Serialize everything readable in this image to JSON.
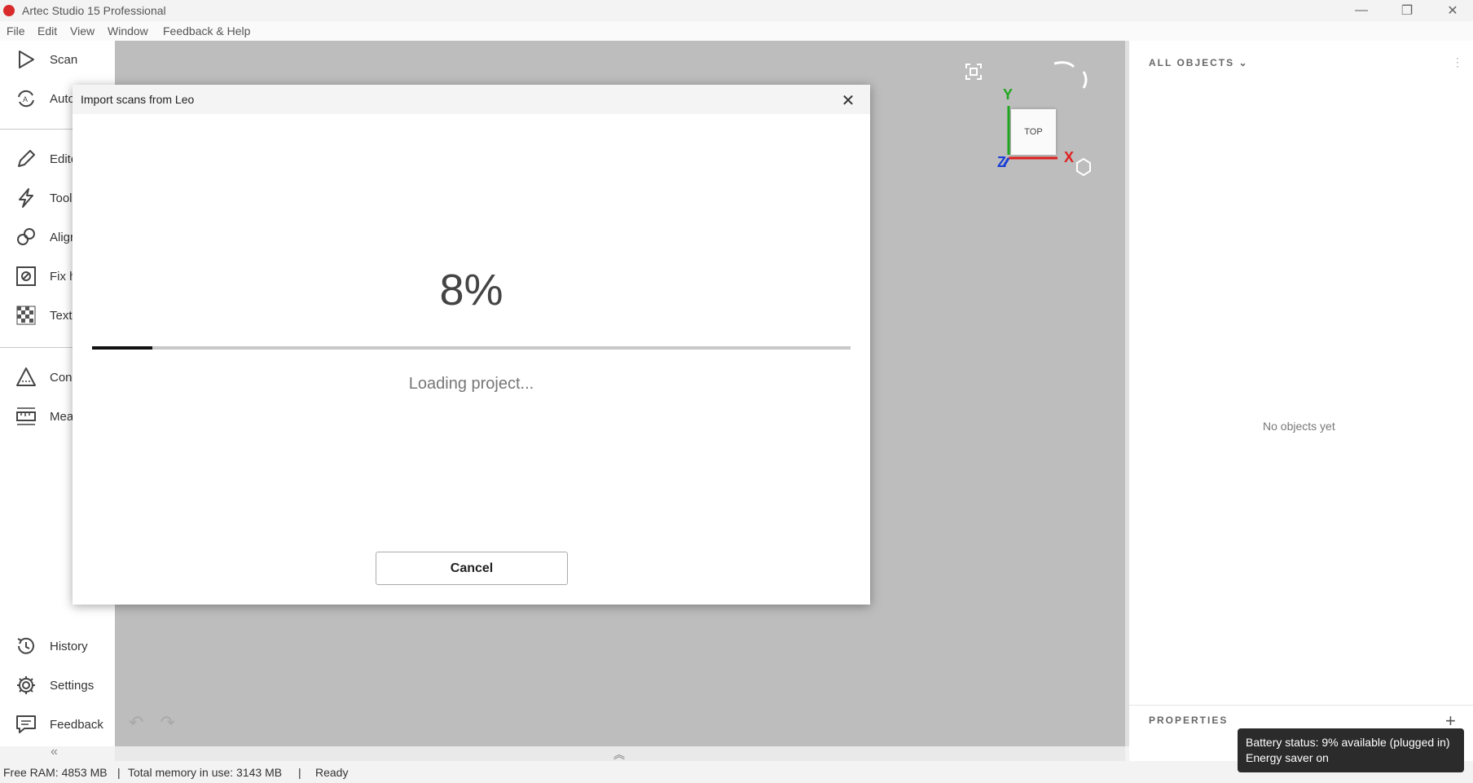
{
  "window": {
    "title": "Artec Studio 15 Professional",
    "minimize_glyph": "—",
    "restore_glyph": "❐",
    "close_glyph": "✕"
  },
  "menu": {
    "items": [
      "File",
      "Edit",
      "View",
      "Window",
      "Feedback & Help"
    ]
  },
  "sidebar": {
    "items": [
      {
        "label": "Scan",
        "icon": "scan-icon"
      },
      {
        "label": "Auto",
        "icon": "autopilot-icon"
      },
      {
        "label": "Edito",
        "icon": "pencil-icon"
      },
      {
        "label": "Tool",
        "icon": "lightning-icon"
      },
      {
        "label": "Aligr",
        "icon": "align-icon"
      },
      {
        "label": "Fix h",
        "icon": "fix-holes-icon"
      },
      {
        "label": "Text",
        "icon": "texture-icon"
      },
      {
        "label": "Cons",
        "icon": "construct-icon"
      },
      {
        "label": "Mea",
        "icon": "ruler-icon"
      }
    ],
    "bottom_items": [
      {
        "label": "History",
        "icon": "history-icon"
      },
      {
        "label": "Settings",
        "icon": "gear-icon"
      },
      {
        "label": "Feedback",
        "icon": "chat-icon"
      }
    ],
    "collapse_glyph": "«"
  },
  "viewport": {
    "view_cube_label": "TOP",
    "axis_x": "X",
    "axis_y": "Y",
    "axis_z": "Z",
    "expand_glyph": "︽"
  },
  "right_panel": {
    "heading": "ALL OBJECTS",
    "empty_text": "No objects yet",
    "properties_label": "PROPERTIES",
    "add_glyph": "+"
  },
  "dialog": {
    "title": "Import scans from Leo",
    "percent_text": "8%",
    "progress": 0.08,
    "status": "Loading project...",
    "cancel_label": "Cancel"
  },
  "statusbar": {
    "free_ram": "Free RAM: 4853 MB",
    "total_memory": "Total memory in use: 3143 MB",
    "sep": "|",
    "state": "Ready"
  },
  "tooltip": {
    "line1": "Battery status: 9% available (plugged in)",
    "line2": "Energy saver on"
  },
  "colors": {
    "accent_red": "#d92b2b",
    "axis_x": "#e02020",
    "axis_y": "#1fa81f",
    "axis_z": "#1b3fd6"
  }
}
